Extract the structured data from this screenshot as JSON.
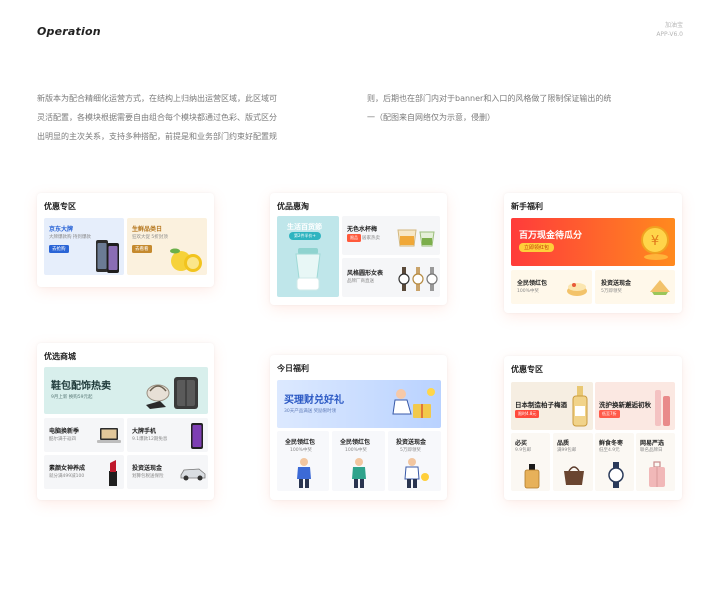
{
  "header": {
    "title": "Operation",
    "brand_line1": "加油宝",
    "brand_line2": "APP-V6.0"
  },
  "intro": {
    "col1": [
      "新版本为配合精细化运营方式，在结构上归纳出运营区域，此区域可",
      "灵活配置，各模块根据需要自由组合每个模块都通过色彩、版式区分",
      "出明显的主次关系，支持多种搭配，前提是和业务部门约束好配置规"
    ],
    "col2": [
      "则，后期也在部门内对于banner和入口的风格做了限制保证输出的统",
      "一（配图来自网络仅为示意，侵删）"
    ]
  },
  "cards": {
    "c1": {
      "title": "优惠专区",
      "left": {
        "title": "京东大牌",
        "sub": "大牌爆款购 持到爆款",
        "btn": "去抢购"
      },
      "right": {
        "title": "生鲜品类日",
        "sub": "狂欢大促 5折封顶",
        "btn": "去看看"
      }
    },
    "c2": {
      "title": "优品惠淘",
      "banner_title": "生活百货節",
      "banner_badge": "第2件半价+",
      "item1": {
        "title": "无色水杯梅",
        "badge": "限品",
        "sub": "居家热卖"
      },
      "item2": {
        "title": "风格圆形女表",
        "sub": "品牌厂商直送"
      }
    },
    "c3": {
      "title": "新手福利",
      "banner_title": "百万现金待瓜分",
      "banner_btn": "立即领红包",
      "item1": {
        "title": "全民领红包",
        "sub": "100%中奖"
      },
      "item2": {
        "title": "投资送现金",
        "sub": "5万即领奖"
      }
    },
    "c4": {
      "title": "优选商城",
      "banner_title": "鞋包配饰热卖",
      "banner_sub": "9月上新 换购59元起",
      "grid": [
        {
          "title": "电脑换新季",
          "sub": "酷尔满于返四"
        },
        {
          "title": "大牌手机",
          "sub": "9.1爆款12期免息"
        },
        {
          "title": "素颜女神养成",
          "sub": "就分满499减100"
        },
        {
          "title": "投资送现金",
          "sub": "划算包税送保险"
        }
      ]
    },
    "c5": {
      "title": "今日福利",
      "banner_title": "买理财兑好礼",
      "banner_sub": "30天产品满送 奖励限时领",
      "items": [
        {
          "title": "全民领红包",
          "sub": "100%中奖"
        },
        {
          "title": "全民领红包",
          "sub": "100%中奖"
        },
        {
          "title": "投资送现金",
          "sub": "5万即领奖"
        }
      ]
    },
    "c6": {
      "title": "优惠专区",
      "left": {
        "title": "日本制造柏子梅酒",
        "tag": "限时4.8元"
      },
      "right": {
        "title": "洗护换新邂逅初秋",
        "tag": "低至7折"
      },
      "items": [
        {
          "title": "必买",
          "sub": "9.9包邮"
        },
        {
          "title": "品质",
          "sub": "满99包邮"
        },
        {
          "title": "鲜食冬枣",
          "sub": "低至4.9元"
        },
        {
          "title": "网易严选",
          "sub": "联名品牌日"
        }
      ]
    }
  },
  "colors": {
    "accent_red": "#ff4a3c",
    "accent_orange": "#ff7d1e",
    "blue_text": "#2a64d6"
  }
}
